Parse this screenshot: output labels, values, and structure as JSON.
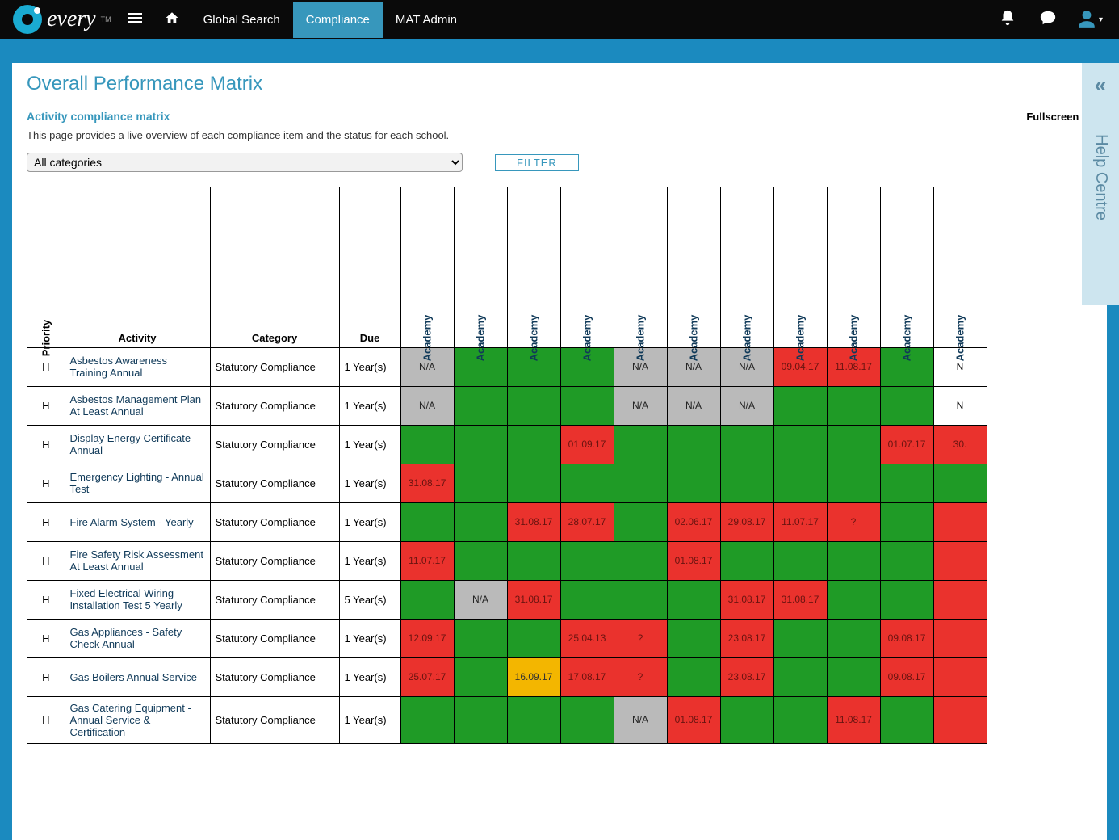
{
  "nav": {
    "brand": "every",
    "items": [
      "Global Search",
      "Compliance",
      "MAT Admin"
    ],
    "active_index": 1
  },
  "page": {
    "title": "Overall Performance Matrix",
    "subtitle": "Activity compliance matrix",
    "fullscreen_label": "Fullscreen",
    "description": "This page provides a live overview of each compliance item and the status for each school.",
    "filter_label": "FILTER",
    "category_select": "All categories"
  },
  "help_tab": "Help Centre",
  "table": {
    "headers": {
      "priority": "Priority",
      "activity": "Activity",
      "category": "Category",
      "due": "Due"
    },
    "academy_count": 11,
    "academy_label": "Academy",
    "rows": [
      {
        "priority": "H",
        "activity": "Asbestos Awareness Training Annual",
        "category": "Statutory Compliance",
        "due": "1 Year(s)",
        "cells": [
          {
            "s": "grey",
            "t": "N/A"
          },
          {
            "s": "green",
            "t": ""
          },
          {
            "s": "green",
            "t": ""
          },
          {
            "s": "green",
            "t": ""
          },
          {
            "s": "grey",
            "t": "N/A"
          },
          {
            "s": "grey",
            "t": "N/A"
          },
          {
            "s": "grey",
            "t": "N/A"
          },
          {
            "s": "red",
            "t": "09.04.17"
          },
          {
            "s": "red",
            "t": "11.08.17"
          },
          {
            "s": "green",
            "t": ""
          },
          {
            "s": "white",
            "t": "N"
          }
        ]
      },
      {
        "priority": "H",
        "activity": "Asbestos Management Plan At Least Annual",
        "category": "Statutory Compliance",
        "due": "1 Year(s)",
        "cells": [
          {
            "s": "grey",
            "t": "N/A"
          },
          {
            "s": "green",
            "t": ""
          },
          {
            "s": "green",
            "t": ""
          },
          {
            "s": "green",
            "t": ""
          },
          {
            "s": "grey",
            "t": "N/A"
          },
          {
            "s": "grey",
            "t": "N/A"
          },
          {
            "s": "grey",
            "t": "N/A"
          },
          {
            "s": "green",
            "t": ""
          },
          {
            "s": "green",
            "t": ""
          },
          {
            "s": "green",
            "t": ""
          },
          {
            "s": "white",
            "t": "N"
          }
        ]
      },
      {
        "priority": "H",
        "activity": "Display Energy Certificate Annual",
        "category": "Statutory Compliance",
        "due": "1 Year(s)",
        "cells": [
          {
            "s": "green",
            "t": ""
          },
          {
            "s": "green",
            "t": ""
          },
          {
            "s": "green",
            "t": ""
          },
          {
            "s": "red",
            "t": "01.09.17"
          },
          {
            "s": "green",
            "t": ""
          },
          {
            "s": "green",
            "t": ""
          },
          {
            "s": "green",
            "t": ""
          },
          {
            "s": "green",
            "t": ""
          },
          {
            "s": "green",
            "t": ""
          },
          {
            "s": "red",
            "t": "01.07.17"
          },
          {
            "s": "red",
            "t": "30."
          }
        ]
      },
      {
        "priority": "H",
        "activity": "Emergency Lighting - Annual Test",
        "category": "Statutory Compliance",
        "due": "1 Year(s)",
        "cells": [
          {
            "s": "red",
            "t": "31.08.17"
          },
          {
            "s": "green",
            "t": ""
          },
          {
            "s": "green",
            "t": ""
          },
          {
            "s": "green",
            "t": ""
          },
          {
            "s": "green",
            "t": ""
          },
          {
            "s": "green",
            "t": ""
          },
          {
            "s": "green",
            "t": ""
          },
          {
            "s": "green",
            "t": ""
          },
          {
            "s": "green",
            "t": ""
          },
          {
            "s": "green",
            "t": ""
          },
          {
            "s": "green",
            "t": ""
          }
        ]
      },
      {
        "priority": "H",
        "activity": "Fire Alarm System - Yearly",
        "category": "Statutory Compliance",
        "due": "1 Year(s)",
        "cells": [
          {
            "s": "green",
            "t": ""
          },
          {
            "s": "green",
            "t": ""
          },
          {
            "s": "red",
            "t": "31.08.17"
          },
          {
            "s": "red",
            "t": "28.07.17"
          },
          {
            "s": "green",
            "t": ""
          },
          {
            "s": "red",
            "t": "02.06.17"
          },
          {
            "s": "red",
            "t": "29.08.17"
          },
          {
            "s": "red",
            "t": "11.07.17"
          },
          {
            "s": "red",
            "t": "?"
          },
          {
            "s": "green",
            "t": ""
          },
          {
            "s": "red",
            "t": ""
          }
        ]
      },
      {
        "priority": "H",
        "activity": "Fire Safety Risk Assessment At Least Annual",
        "category": "Statutory Compliance",
        "due": "1 Year(s)",
        "cells": [
          {
            "s": "red",
            "t": "11.07.17"
          },
          {
            "s": "green",
            "t": ""
          },
          {
            "s": "green",
            "t": ""
          },
          {
            "s": "green",
            "t": ""
          },
          {
            "s": "green",
            "t": ""
          },
          {
            "s": "red",
            "t": "01.08.17"
          },
          {
            "s": "green",
            "t": ""
          },
          {
            "s": "green",
            "t": ""
          },
          {
            "s": "green",
            "t": ""
          },
          {
            "s": "green",
            "t": ""
          },
          {
            "s": "red",
            "t": ""
          }
        ]
      },
      {
        "priority": "H",
        "activity": "Fixed Electrical Wiring Installation Test 5 Yearly",
        "category": "Statutory Compliance",
        "due": "5 Year(s)",
        "cells": [
          {
            "s": "green",
            "t": ""
          },
          {
            "s": "grey",
            "t": "N/A"
          },
          {
            "s": "red",
            "t": "31.08.17"
          },
          {
            "s": "green",
            "t": ""
          },
          {
            "s": "green",
            "t": ""
          },
          {
            "s": "green",
            "t": ""
          },
          {
            "s": "red",
            "t": "31.08.17"
          },
          {
            "s": "red",
            "t": "31.08.17"
          },
          {
            "s": "green",
            "t": ""
          },
          {
            "s": "green",
            "t": ""
          },
          {
            "s": "red",
            "t": ""
          }
        ]
      },
      {
        "priority": "H",
        "activity": "Gas Appliances - Safety Check Annual",
        "category": "Statutory Compliance",
        "due": "1 Year(s)",
        "cells": [
          {
            "s": "red",
            "t": "12.09.17"
          },
          {
            "s": "green",
            "t": ""
          },
          {
            "s": "green",
            "t": ""
          },
          {
            "s": "red",
            "t": "25.04.13"
          },
          {
            "s": "red",
            "t": "?"
          },
          {
            "s": "green",
            "t": ""
          },
          {
            "s": "red",
            "t": "23.08.17"
          },
          {
            "s": "green",
            "t": ""
          },
          {
            "s": "green",
            "t": ""
          },
          {
            "s": "red",
            "t": "09.08.17"
          },
          {
            "s": "red",
            "t": ""
          }
        ]
      },
      {
        "priority": "H",
        "activity": "Gas Boilers Annual Service",
        "category": "Statutory Compliance",
        "due": "1 Year(s)",
        "cells": [
          {
            "s": "red",
            "t": "25.07.17"
          },
          {
            "s": "green",
            "t": ""
          },
          {
            "s": "yellow",
            "t": "16.09.17"
          },
          {
            "s": "red",
            "t": "17.08.17"
          },
          {
            "s": "red",
            "t": "?"
          },
          {
            "s": "green",
            "t": ""
          },
          {
            "s": "red",
            "t": "23.08.17"
          },
          {
            "s": "green",
            "t": ""
          },
          {
            "s": "green",
            "t": ""
          },
          {
            "s": "red",
            "t": "09.08.17"
          },
          {
            "s": "red",
            "t": ""
          }
        ]
      },
      {
        "priority": "H",
        "activity": "Gas Catering Equipment - Annual Service & Certification",
        "category": "Statutory Compliance",
        "due": "1 Year(s)",
        "cells": [
          {
            "s": "green",
            "t": ""
          },
          {
            "s": "green",
            "t": ""
          },
          {
            "s": "green",
            "t": ""
          },
          {
            "s": "green",
            "t": ""
          },
          {
            "s": "grey",
            "t": "N/A"
          },
          {
            "s": "red",
            "t": "01.08.17"
          },
          {
            "s": "green",
            "t": ""
          },
          {
            "s": "green",
            "t": ""
          },
          {
            "s": "red",
            "t": "11.08.17"
          },
          {
            "s": "green",
            "t": ""
          },
          {
            "s": "red",
            "t": ""
          }
        ]
      }
    ]
  }
}
